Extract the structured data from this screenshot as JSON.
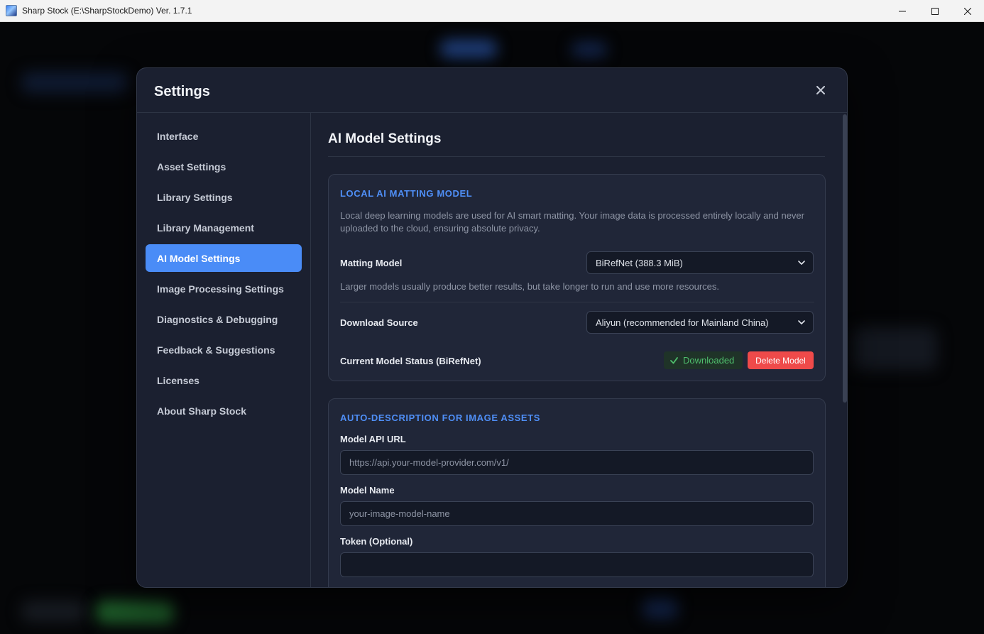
{
  "window": {
    "title": "Sharp Stock (E:\\SharpStockDemo) Ver. 1.7.1",
    "minimize_icon": "minimize-icon",
    "maximize_icon": "maximize-icon",
    "close_icon": "close-icon"
  },
  "modal": {
    "title": "Settings",
    "close_icon": "close-icon"
  },
  "sidebar": {
    "items": [
      {
        "label": "Interface"
      },
      {
        "label": "Asset Settings"
      },
      {
        "label": "Library Settings"
      },
      {
        "label": "Library Management"
      },
      {
        "label": "AI Model Settings",
        "active": true
      },
      {
        "label": "Image Processing Settings"
      },
      {
        "label": "Diagnostics & Debugging"
      },
      {
        "label": "Feedback & Suggestions"
      },
      {
        "label": "Licenses"
      },
      {
        "label": "About Sharp Stock"
      }
    ]
  },
  "content": {
    "title": "AI Model Settings",
    "local_model": {
      "heading": "LOCAL AI MATTING MODEL",
      "description": "Local deep learning models are used for AI smart matting. Your image data is processed entirely locally and never uploaded to the cloud, ensuring absolute privacy.",
      "matting_model_label": "Matting Model",
      "matting_model_value": "BiRefNet (388.3 MiB)",
      "matting_model_hint": "Larger models usually produce better results, but take longer to run and use more resources.",
      "download_source_label": "Download Source",
      "download_source_value": "Aliyun (recommended for Mainland China)",
      "status_label": "Current Model Status (BiRefNet)",
      "status_value": "Downloaded",
      "delete_button": "Delete Model"
    },
    "auto_description": {
      "heading": "AUTO-DESCRIPTION FOR IMAGE ASSETS",
      "api_url_label": "Model API URL",
      "api_url_placeholder": "https://api.your-model-provider.com/v1/",
      "model_name_label": "Model Name",
      "model_name_placeholder": "your-image-model-name",
      "token_label": "Token (Optional)",
      "token_placeholder": ""
    }
  },
  "colors": {
    "accent": "#4a8cf7",
    "success": "#4fbf6d",
    "danger": "#ef4a4a",
    "modal_bg": "#1b2030"
  }
}
